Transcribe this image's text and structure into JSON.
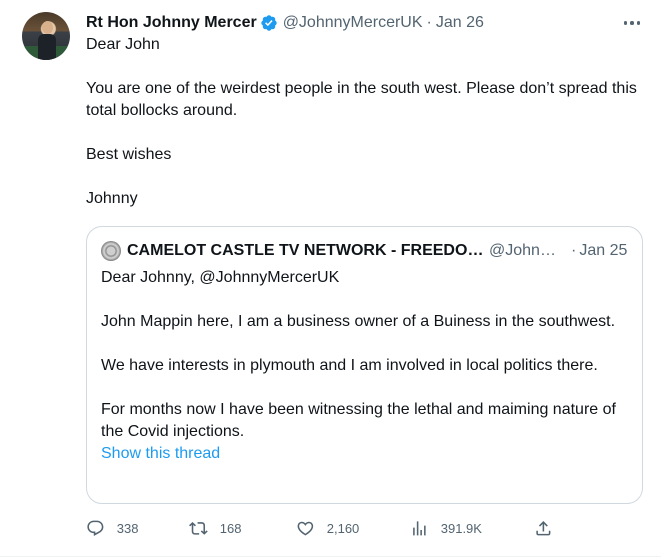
{
  "tweet": {
    "author_name": "Rt Hon Johnny Mercer",
    "handle": "@JohnnyMercerUK",
    "separator": "·",
    "date": "Jan 26",
    "lines": [
      "Dear John",
      "",
      "You are one of the weirdest people in the south west. Please don’t spread this total bollocks around.",
      "",
      "Best wishes",
      "",
      "Johnny"
    ]
  },
  "quote": {
    "author_name": "CAMELOT CASTLE TV NETWORK - FREEDOM NEWS",
    "handle": "@JohnMappin",
    "separator": "·",
    "date": "Jan 25",
    "lines": [
      "Dear Johnny,  @JohnnyMercerUK",
      "",
      "John Mappin here, I am a business owner of a Buiness in the southwest.",
      "",
      "We have interests in plymouth and I am involved in local politics there.",
      "",
      "For months now I have been witnessing the lethal and maiming nature of the Covid injections."
    ],
    "show_thread": "Show this thread"
  },
  "actions": {
    "replies": "338",
    "retweets": "168",
    "likes": "2,160",
    "views": "391.9K"
  },
  "icons": {
    "verified": "verified-badge-icon",
    "more": "more-dots-icon",
    "reply": "reply-icon",
    "retweet": "retweet-icon",
    "like": "heart-icon",
    "views": "views-chart-icon",
    "share": "share-icon"
  },
  "colors": {
    "text": "#0f1419",
    "secondary": "#536471",
    "link": "#1d9bf0",
    "border": "#cfd9de",
    "verified": "#1d9bf0"
  }
}
